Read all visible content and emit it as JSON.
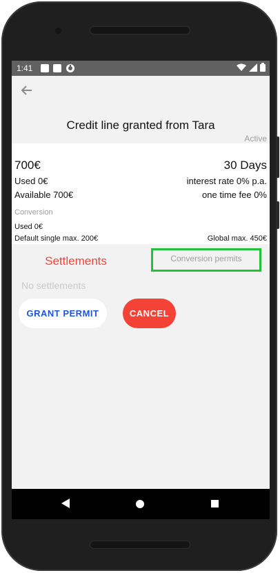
{
  "status_bar": {
    "time": "1:41"
  },
  "header": {
    "title": "Credit line granted from Tara",
    "status": "Active"
  },
  "summary": {
    "amount": "700€",
    "duration": "30 Days",
    "used": "Used 0€",
    "available": "Available 700€",
    "interest": "interest rate 0% p.a.",
    "fee": "one time fee 0%"
  },
  "conversion": {
    "label": "Conversion",
    "used": "Used 0€",
    "single_max": "Default single max. 200€",
    "global_max": "Global max. 450€"
  },
  "tabs": {
    "settlements": "Settlements",
    "permits": "Conversion permits"
  },
  "empty_state": "No settlements",
  "actions": {
    "grant": "GRANT PERMIT",
    "cancel": "CANCEL"
  },
  "colors": {
    "accent": "#f44336",
    "primary_text_button": "#1e56d8",
    "highlight": "#21c13a"
  }
}
